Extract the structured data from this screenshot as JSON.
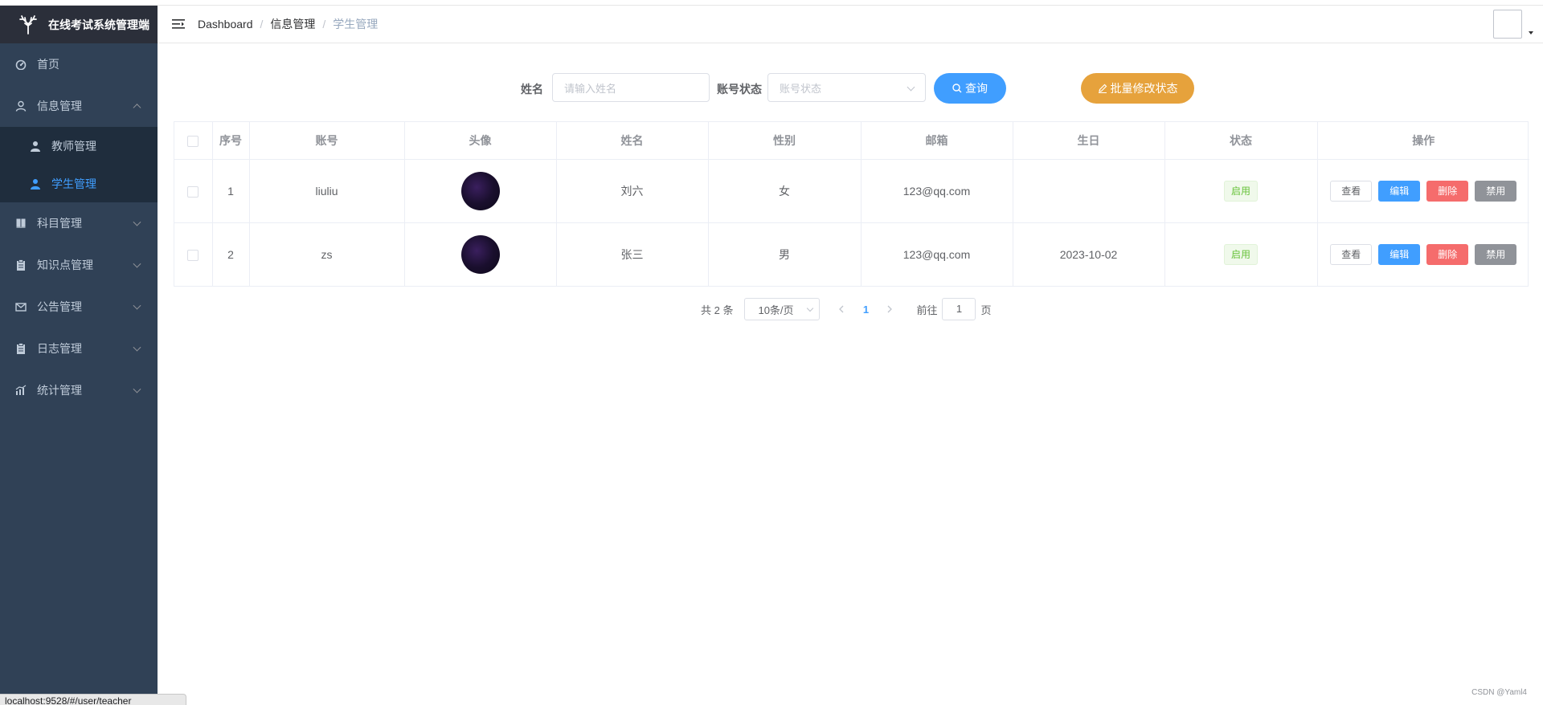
{
  "app": {
    "title": "在线考试系统管理端"
  },
  "sidebar": {
    "items": [
      {
        "label": "首页",
        "icon": "dashboard-icon"
      },
      {
        "label": "信息管理",
        "icon": "user-icon",
        "expanded": true,
        "children": [
          {
            "label": "教师管理",
            "icon": "person-icon"
          },
          {
            "label": "学生管理",
            "icon": "person-icon",
            "active": true
          }
        ]
      },
      {
        "label": "科目管理",
        "icon": "book-icon"
      },
      {
        "label": "知识点管理",
        "icon": "clipboard-icon"
      },
      {
        "label": "公告管理",
        "icon": "message-icon"
      },
      {
        "label": "日志管理",
        "icon": "clipboard-icon"
      },
      {
        "label": "统计管理",
        "icon": "chart-icon"
      }
    ]
  },
  "breadcrumb": {
    "items": [
      "Dashboard",
      "信息管理",
      "学生管理"
    ],
    "separator": "/"
  },
  "search": {
    "name_label": "姓名",
    "name_placeholder": "请输入姓名",
    "status_label": "账号状态",
    "status_placeholder": "账号状态",
    "query_button": "查询",
    "batch_button": "批量修改状态"
  },
  "table": {
    "headers": [
      "序号",
      "账号",
      "头像",
      "姓名",
      "性别",
      "邮箱",
      "生日",
      "状态",
      "操作"
    ],
    "rows": [
      {
        "index": "1",
        "account": "liuliu",
        "name": "刘六",
        "gender": "女",
        "email": "123@qq.com",
        "birthday": "",
        "status": "启用"
      },
      {
        "index": "2",
        "account": "zs",
        "name": "张三",
        "gender": "男",
        "email": "123@qq.com",
        "birthday": "2023-10-02",
        "status": "启用"
      }
    ],
    "actions": {
      "view": "查看",
      "edit": "编辑",
      "delete": "删除",
      "disable": "禁用"
    }
  },
  "pagination": {
    "total_text": "共 2 条",
    "page_size": "10条/页",
    "current_page": "1",
    "goto_prefix": "前往",
    "goto_value": "1",
    "goto_suffix": "页"
  },
  "statusbar": {
    "url": "localhost:9528/#/user/teacher"
  },
  "watermark": "CSDN @Yaml4",
  "colors": {
    "sidebar_bg": "#304156",
    "primary": "#409eff",
    "warning": "#e6a23c",
    "danger": "#f56c6c",
    "info": "#909399",
    "success": "#67c23a"
  }
}
